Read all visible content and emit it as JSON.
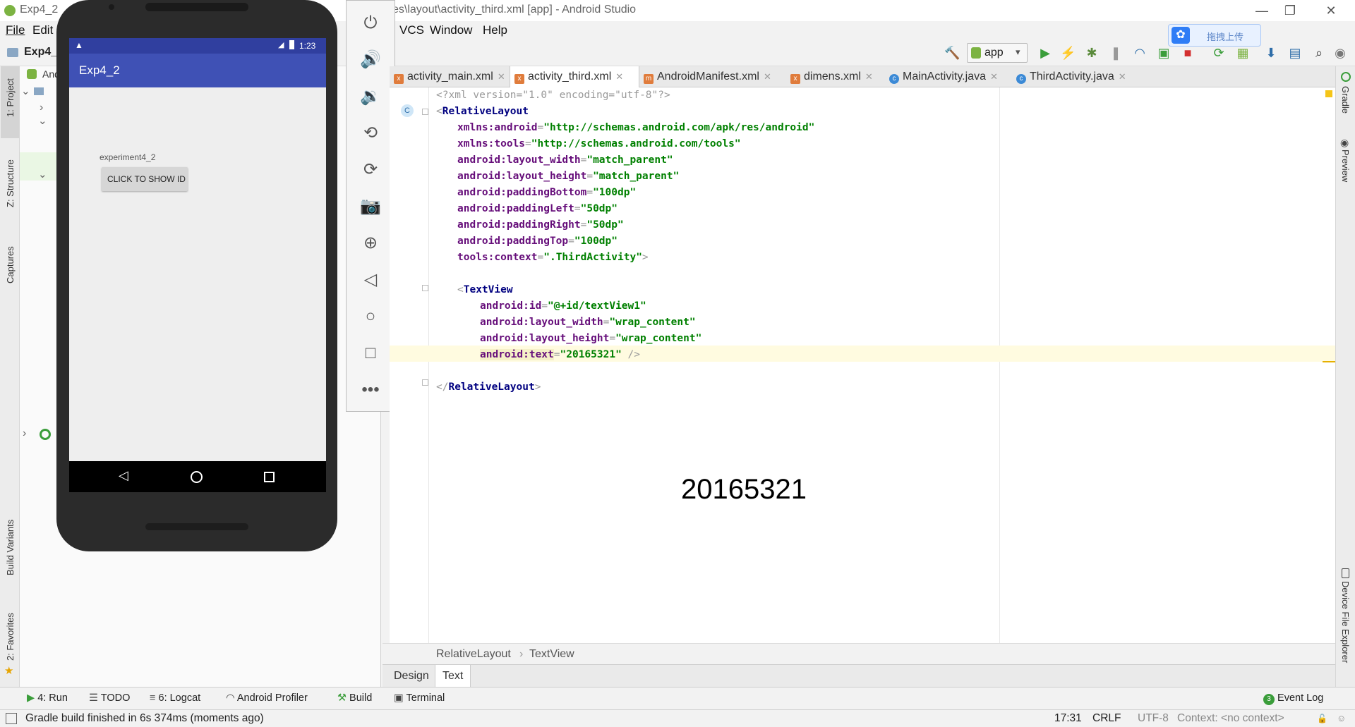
{
  "window": {
    "title_left": "Exp4_2",
    "title_right": "es\\layout\\activity_third.xml [app] - Android Studio",
    "controls": [
      "—",
      "❐",
      "✕"
    ]
  },
  "menu": {
    "left_items": [
      "File",
      "Edit"
    ],
    "right_items": [
      "VCS",
      "Window",
      "Help"
    ]
  },
  "toolbar": {
    "project_label": "Exp4_",
    "run_config": "app"
  },
  "cloud_widget": {
    "label": "拖拽上传"
  },
  "tabs": [
    {
      "label": "activity_main.xml",
      "icon": "xml-file-icon"
    },
    {
      "label": "activity_third.xml",
      "icon": "xml-file-icon",
      "active": true
    },
    {
      "label": "AndroidManifest.xml",
      "icon": "manifest-file-icon"
    },
    {
      "label": "dimens.xml",
      "icon": "xml-file-icon"
    },
    {
      "label": "MainActivity.java",
      "icon": "java-class-icon"
    },
    {
      "label": "ThirdActivity.java",
      "icon": "java-class-icon"
    }
  ],
  "left_stripe": {
    "project": "1: Project",
    "structure": "Z: Structure",
    "captures": "Captures",
    "build_variants": "Build Variants",
    "favorites": "2: Favorites"
  },
  "right_stripe": {
    "gradle": "Gradle",
    "preview": "Preview",
    "device_file_explorer": "Device File Explorer"
  },
  "project_panel": {
    "partial_label": "And"
  },
  "code": {
    "line1_pi": "<?xml version=\"1.0\" encoding=\"utf-8\"?>",
    "rel_open": "RelativeLayout",
    "attrs": [
      {
        "name": "xmlns:android",
        "value": "http://schemas.android.com/apk/res/android"
      },
      {
        "name": "xmlns:tools",
        "value": "http://schemas.android.com/tools"
      },
      {
        "name": "android:layout_width",
        "value": "match_parent"
      },
      {
        "name": "android:layout_height",
        "value": "match_parent"
      },
      {
        "name": "android:paddingBottom",
        "value": "100dp"
      },
      {
        "name": "android:paddingLeft",
        "value": "50dp"
      },
      {
        "name": "android:paddingRight",
        "value": "50dp"
      },
      {
        "name": "android:paddingTop",
        "value": "100dp"
      },
      {
        "name": "tools:context",
        "value": ".ThirdActivity"
      }
    ],
    "textview_tag": "TextView",
    "tv_attrs": [
      {
        "name": "android:id",
        "value": "@+id/textView1"
      },
      {
        "name": "android:layout_width",
        "value": "wrap_content"
      },
      {
        "name": "android:layout_height",
        "value": "wrap_content"
      },
      {
        "name": "android:text",
        "value": "20165321"
      }
    ],
    "rel_close": "RelativeLayout"
  },
  "preview_text": "20165321",
  "breadcrumb": [
    "RelativeLayout",
    "TextView"
  ],
  "design_tabs": [
    "Design",
    "Text"
  ],
  "bottom_tools": [
    {
      "label": "4: Run",
      "icon": "run-icon"
    },
    {
      "label": "TODO",
      "icon": "todo-icon"
    },
    {
      "label": "6: Logcat",
      "icon": "logcat-icon"
    },
    {
      "label": "Android Profiler",
      "icon": "profiler-icon"
    },
    {
      "label": "Build",
      "icon": "build-icon"
    },
    {
      "label": "Terminal",
      "icon": "terminal-icon"
    }
  ],
  "event_log": {
    "count": "3",
    "label": "Event Log"
  },
  "status": {
    "message": "Gradle build finished in 6s 374ms (moments ago)",
    "position": "17:31",
    "line_sep": "CRLF",
    "encoding": "UTF-8",
    "context": "Context: <no context>"
  },
  "emulator": {
    "time": "1:23",
    "app_title": "Exp4_2",
    "label_text": "experiment4_2",
    "button_text": "CLICK TO SHOW ID"
  },
  "colors": {
    "primary": "#3F51B5",
    "primary_dark": "#303F9F",
    "run_green": "#3a9d3a"
  }
}
